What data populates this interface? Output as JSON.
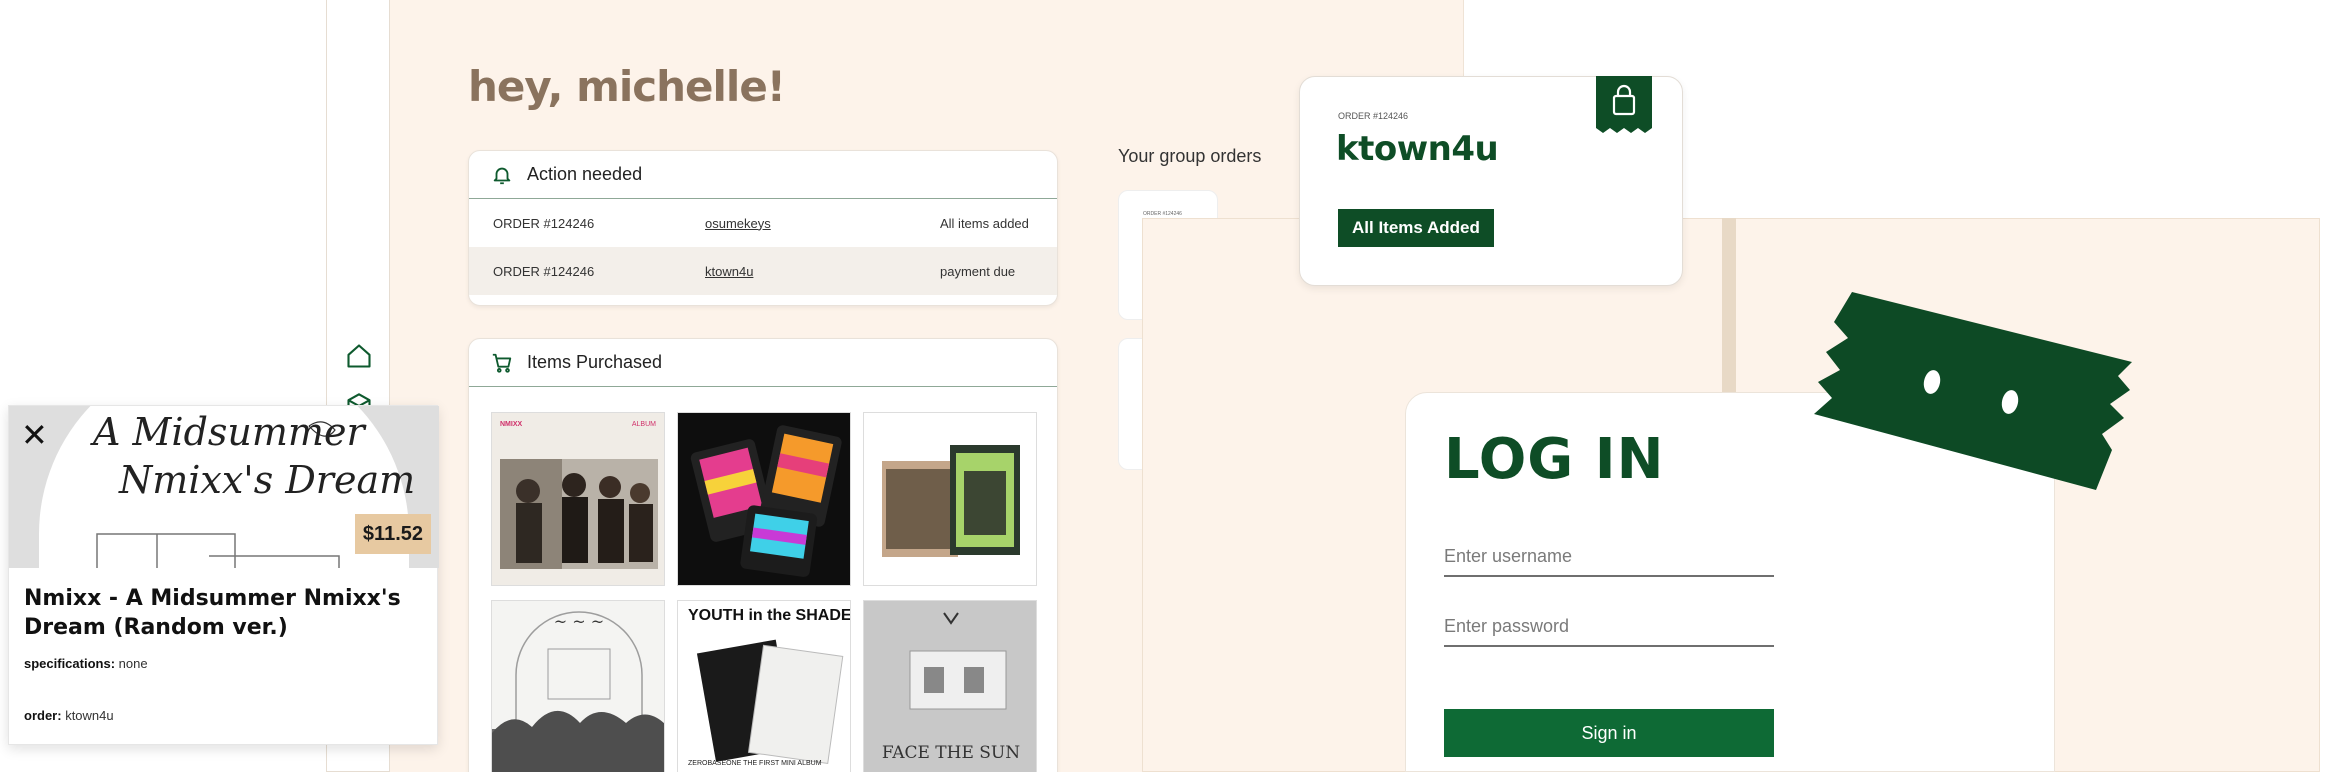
{
  "dashboard": {
    "greeting": "hey, michelle!",
    "action_needed": {
      "title": "Action needed",
      "rows": [
        {
          "order": "ORDER #124246",
          "store": "osumekeys",
          "status": "All items added"
        },
        {
          "order": "ORDER #124246",
          "store": "ktown4u",
          "status": "payment due"
        }
      ]
    },
    "items_purchased": {
      "title": "Items Purchased"
    },
    "group_orders": {
      "title": "Your group orders",
      "peek_order": "ORDER #124246"
    }
  },
  "order_card": {
    "order_id": "ORDER #124246",
    "store": "ktown4u",
    "badge": "All Items Added",
    "icon": "shopping-bag-icon"
  },
  "login": {
    "title": "LOG IN",
    "username_placeholder": "Enter username",
    "password_placeholder": "Enter password",
    "sign_in": "Sign in"
  },
  "product_modal": {
    "close": "✕",
    "album_art_line1": "A Midsummer",
    "album_art_line2": "Nmixx's Dream",
    "price": "$11.52",
    "name": "Nmixx - A Midsummer Nmixx's Dream (Random ver.)",
    "spec_label": "specifications:",
    "spec_value": "none",
    "order_label": "order:",
    "order_value": "ktown4u"
  },
  "thumbnails": {
    "t1_brand_left": "NMIXX",
    "t1_brand_right": "ALBUM",
    "t5_title": "YOUTH in the SHADE",
    "t5_caption": "ZEROBASEONE THE FIRST MINI ALBUM",
    "t6_title": "FACE THE SUN"
  },
  "colors": {
    "brand_green": "#0e4d26",
    "button_green": "#0e6a35",
    "cream": "#fdf3ea",
    "greeting_brown": "#8a735e",
    "price_tag": "#e7c9a1"
  }
}
